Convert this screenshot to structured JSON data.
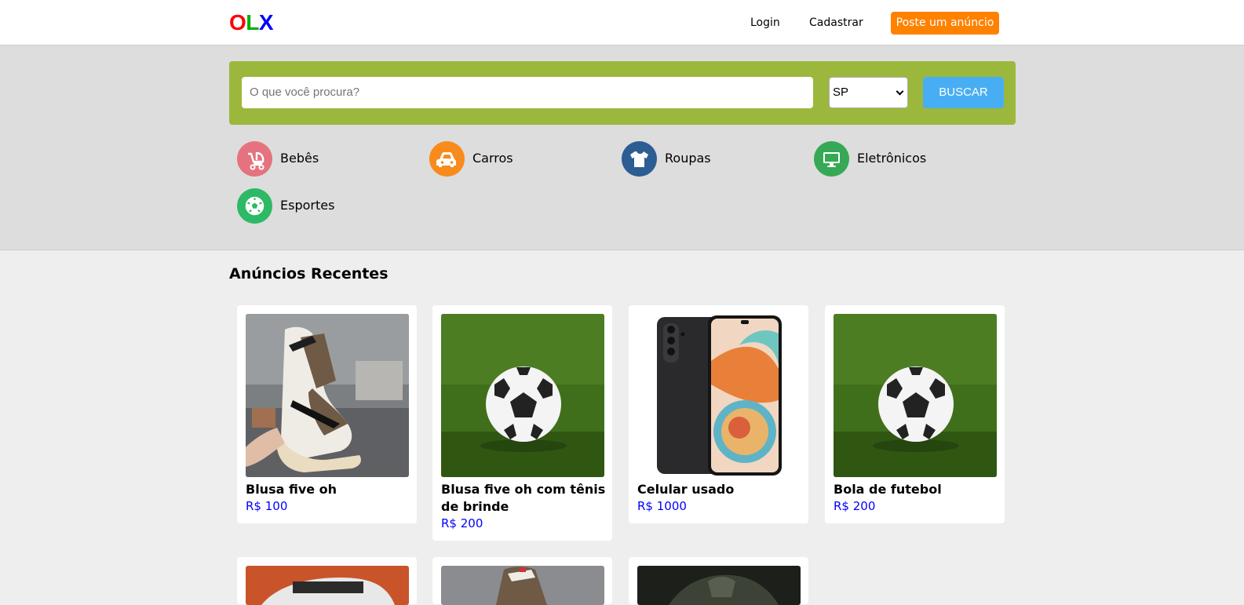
{
  "header": {
    "logo": {
      "o": "O",
      "l": "L",
      "x": "X"
    },
    "login": "Login",
    "register": "Cadastrar",
    "post_ad": "Poste um anúncio"
  },
  "search": {
    "placeholder": "O que você procura?",
    "state": "SP",
    "button": "BUSCAR"
  },
  "categories": [
    {
      "label": "Bebês",
      "icon": "stroller-icon",
      "color": "#e5737f"
    },
    {
      "label": "Carros",
      "icon": "car-icon",
      "color": "#f88b1b"
    },
    {
      "label": "Roupas",
      "icon": "tshirt-icon",
      "color": "#2c5d93"
    },
    {
      "label": "Eletrônicos",
      "icon": "monitor-icon",
      "color": "#37a855"
    },
    {
      "label": "Esportes",
      "icon": "soccer-ball-icon",
      "color": "#2db965"
    }
  ],
  "recent": {
    "title": "Anúncios Recentes",
    "ads": [
      {
        "title": "Blusa five oh",
        "price": "R$ 100",
        "image": "sneaker-photo"
      },
      {
        "title": "Blusa five oh com tênis de brinde",
        "price": "R$ 200",
        "image": "soccer-ball-photo"
      },
      {
        "title": "Celular usado",
        "price": "R$ 1000",
        "image": "smartphone-photo"
      },
      {
        "title": "Bola de futebol",
        "price": "R$ 200",
        "image": "soccer-ball-photo"
      }
    ]
  },
  "colors": {
    "logo_o": "#ff0000",
    "logo_l": "#00b000",
    "logo_x": "#0000ff",
    "post_button": "#ff8100",
    "search_box": "#9bb83d",
    "search_button": "#48aef3",
    "price": "#0000ff"
  }
}
